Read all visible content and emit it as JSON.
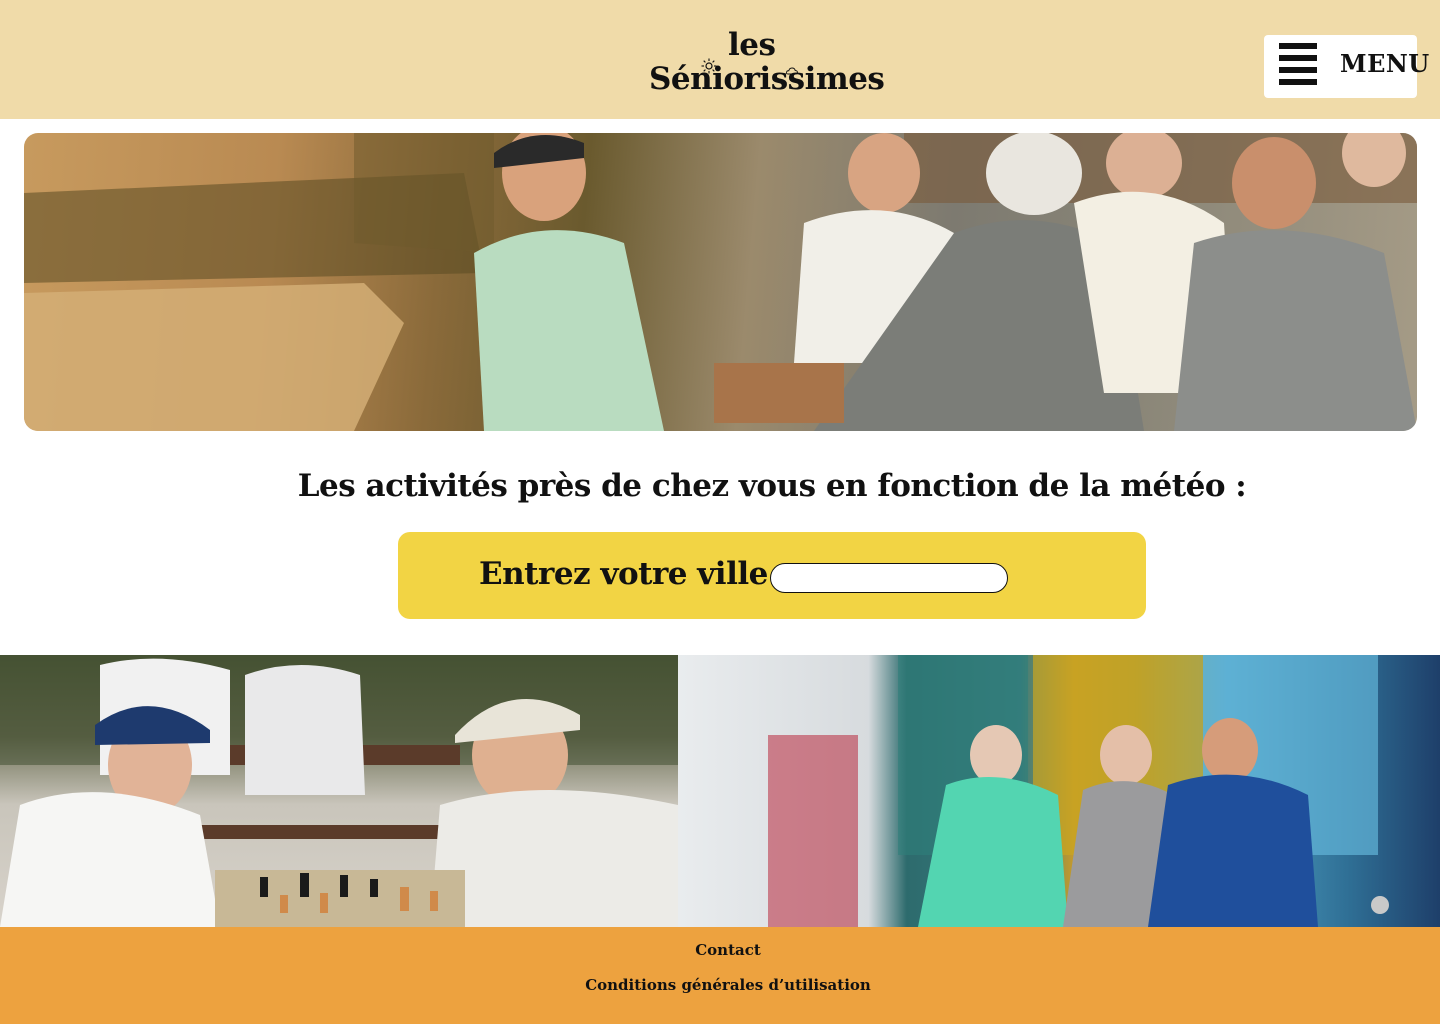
{
  "header": {
    "logo": {
      "line1": "les",
      "line2": "Séniorissimes",
      "sun_icon": "sun-icon",
      "cloud_icon": "cloud-icon"
    },
    "menu": {
      "label": "MENU",
      "icon": "hamburger-icon"
    },
    "background_color": "#f0dba9"
  },
  "hero": {
    "image": "Seniors talking around a table in a park"
  },
  "main": {
    "title": "Les activités près de chez vous en fonction de la météo :",
    "city_prompt": {
      "label": "Entrez votre ville :",
      "input_value": "",
      "box_color": "#f2d444"
    }
  },
  "gallery": {
    "left_image": "Two seniors playing chess outdoors",
    "right_image": "Three seniors walking arm in arm in front of football jerseys"
  },
  "footer": {
    "links": [
      "Contact",
      "Conditions générales d’utilisation"
    ],
    "background_color": "#eda23f"
  }
}
